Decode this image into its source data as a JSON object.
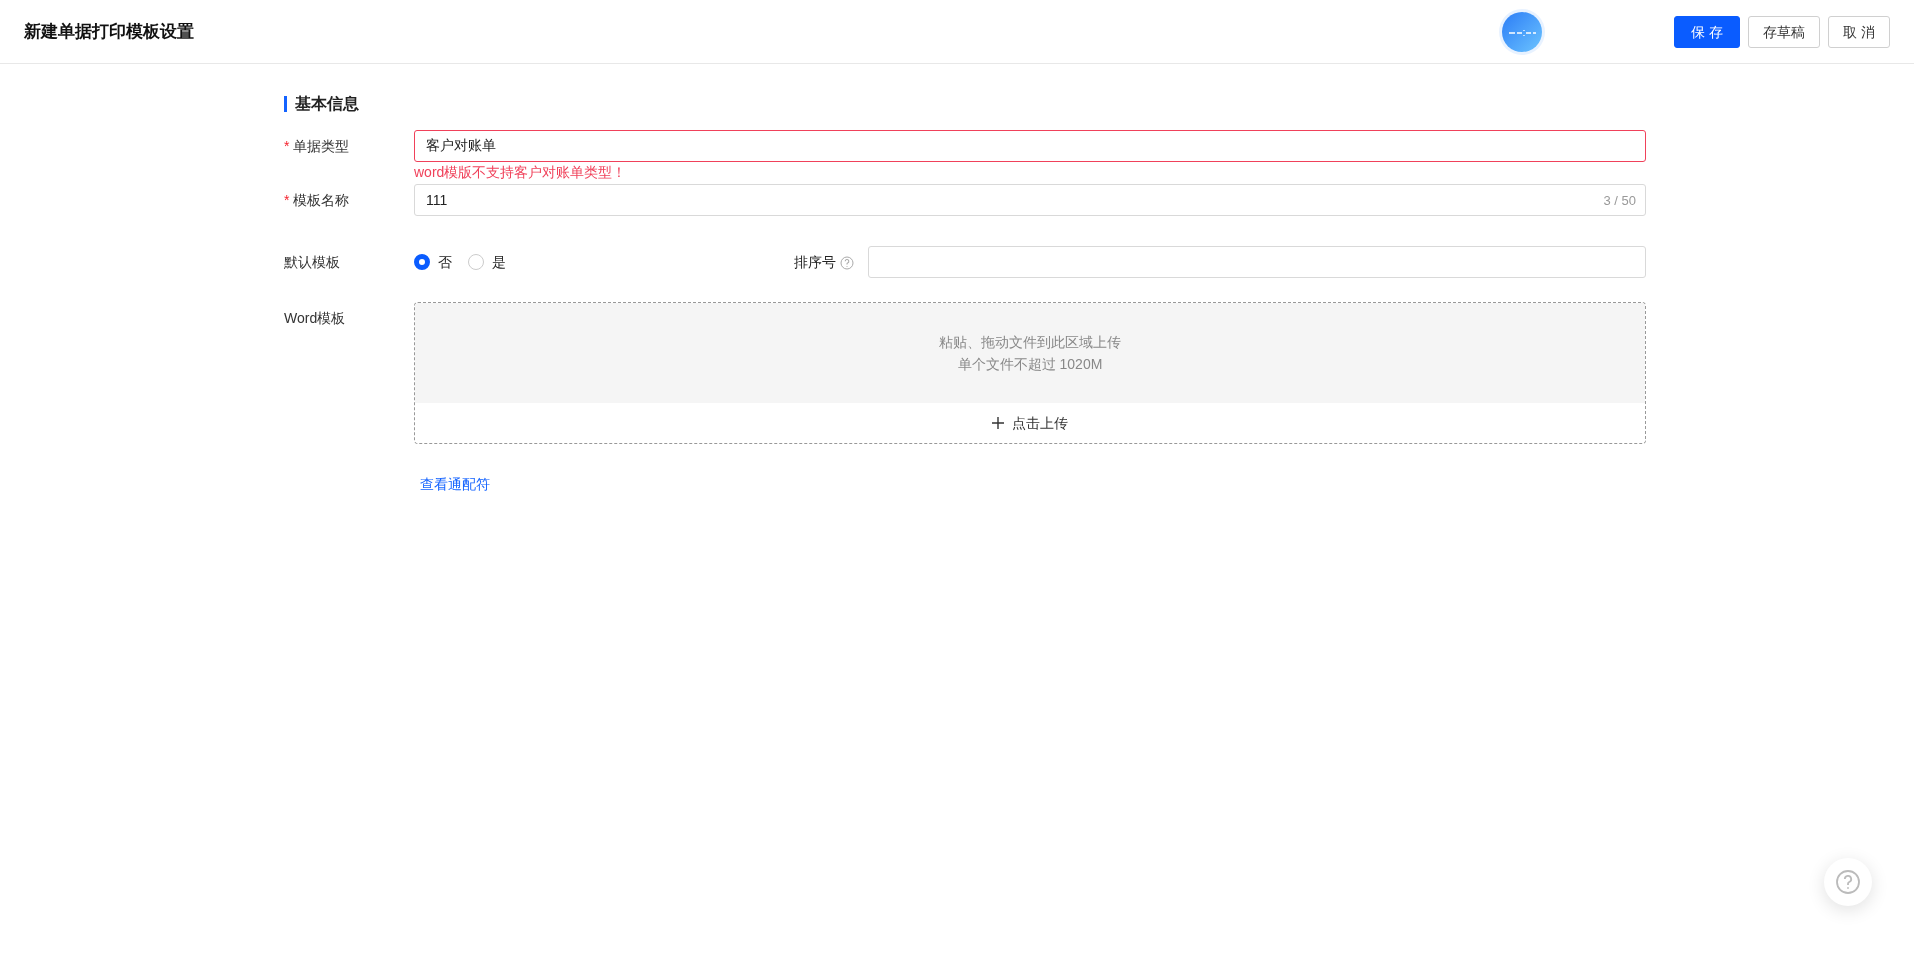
{
  "header": {
    "title": "新建单据打印模板设置",
    "buttons": [
      {
        "label": "保 存",
        "kind": "primary"
      },
      {
        "label": "存草稿",
        "kind": "default"
      },
      {
        "label": "取 消",
        "kind": "default"
      }
    ]
  },
  "section": {
    "title": "基本信息"
  },
  "fields": [
    {
      "label": "单据类型",
      "required_mark": "*",
      "value": "客户对账单",
      "error": "word模版不支持客户对账单类型！"
    },
    {
      "label": "模板名称",
      "required_mark": "*",
      "value": "111",
      "counter": "3 / 50"
    }
  ],
  "default_template": {
    "label": "默认模板",
    "options": [
      {
        "label": "否",
        "selected": true
      },
      {
        "label": "是",
        "selected": false
      }
    ]
  },
  "sort_number": {
    "label": "排序号"
  },
  "word_template": {
    "label": "Word模板",
    "hint_lines": [
      "粘贴、拖动文件到此区域上传",
      "单个文件不超过 1020M"
    ],
    "upload_button": "点击上传"
  },
  "wildcards_link": "查看通配符"
}
